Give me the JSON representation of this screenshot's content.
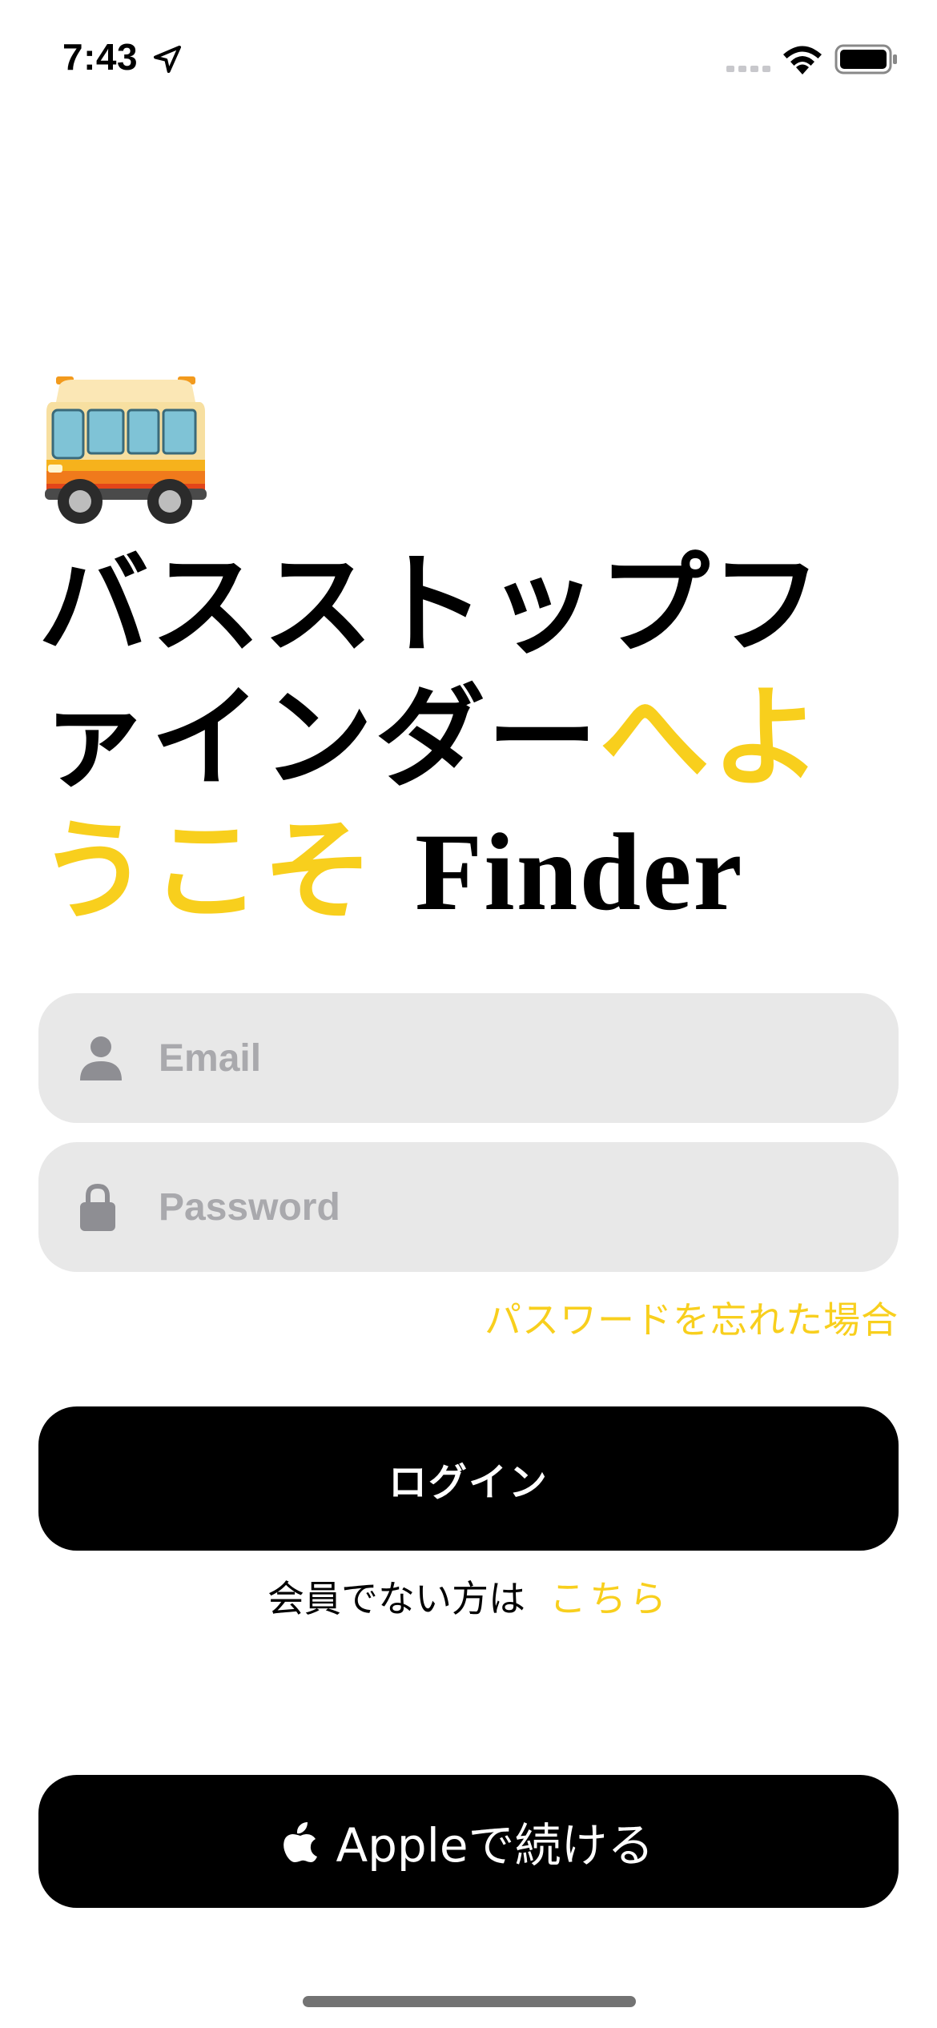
{
  "status_bar": {
    "time": "7:43",
    "icons": [
      "location-arrow-icon",
      "cellular-signal-icon",
      "wifi-icon",
      "battery-icon"
    ]
  },
  "hero": {
    "icon": "bus-icon",
    "title_main": "バスストップファインダー",
    "title_accent": "へようこそ",
    "title_suffix": "Finder"
  },
  "form": {
    "email": {
      "icon": "person-icon",
      "placeholder": "Email",
      "value": ""
    },
    "password": {
      "icon": "lock-icon",
      "placeholder": "Password",
      "value": ""
    },
    "forgot_password_label": "パスワードを忘れた場合"
  },
  "actions": {
    "login_label": "ログイン",
    "signup_prompt": "会員でない方は",
    "signup_link_label": "こちら",
    "apple_label": "Appleで続ける",
    "apple_icon": "apple-logo-icon"
  },
  "colors": {
    "accent": "#f8cf1d",
    "field_background": "#e8e8e8",
    "button_background": "#000000",
    "placeholder": "#a9a9ad"
  }
}
